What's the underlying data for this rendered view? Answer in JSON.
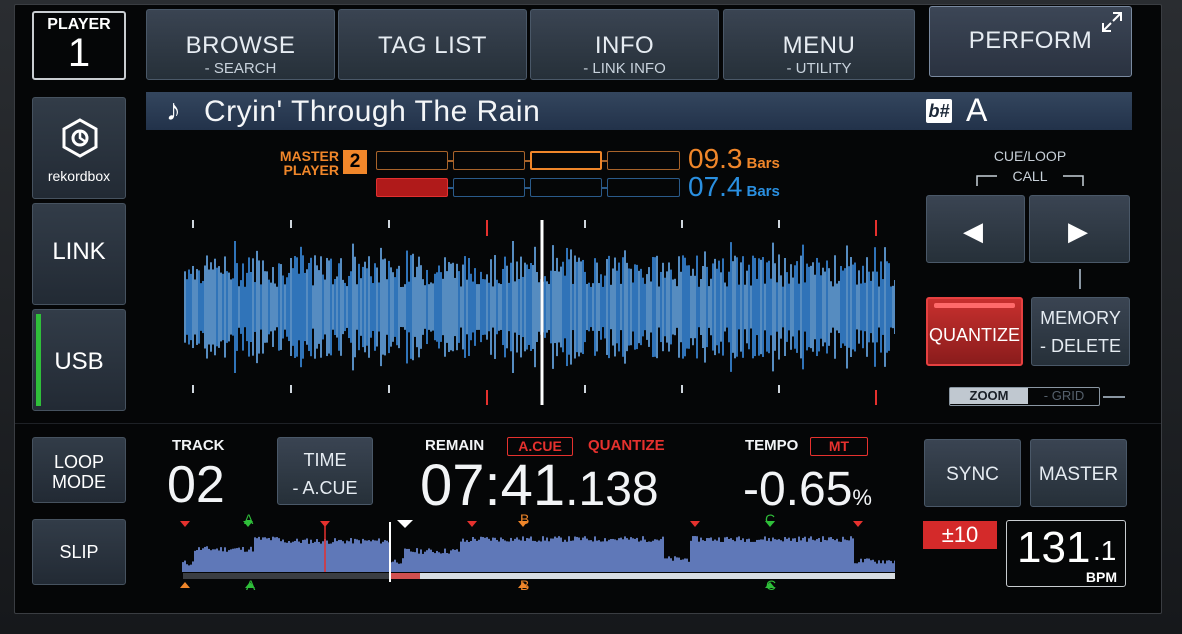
{
  "player": {
    "label": "PLAYER",
    "number": "1"
  },
  "top_buttons": [
    {
      "main": "BROWSE",
      "sub": "- SEARCH"
    },
    {
      "main": "TAG LIST",
      "sub": ""
    },
    {
      "main": "INFO",
      "sub": "- LINK INFO"
    },
    {
      "main": "MENU",
      "sub": "- UTILITY"
    }
  ],
  "perform": {
    "label": "PERFORM"
  },
  "side": {
    "rekordbox": "rekordbox",
    "link": "LINK",
    "usb": "USB",
    "loop_mode": "LOOP MODE",
    "slip": "SLIP"
  },
  "track": {
    "title": "Cryin' Through The Rain",
    "key": "A",
    "key_icon": "b#"
  },
  "phrase": {
    "master_label": "MASTER",
    "player_label": "PLAYER",
    "master_player_num": "2",
    "upper_bars": "09.3",
    "lower_bars": "07.4",
    "bars_unit": "Bars"
  },
  "cue_loop": {
    "label": "CUE/LOOP",
    "call": "CALL"
  },
  "quantize_btn": "QUANTIZE",
  "memory": {
    "main": "MEMORY",
    "sub": "- DELETE"
  },
  "zoom": {
    "zoom": "ZOOM",
    "grid": "- GRID"
  },
  "info": {
    "track_label": "TRACK",
    "track_num": "02",
    "time_btn": {
      "main": "TIME",
      "sub": "- A.CUE"
    },
    "remain_label": "REMAIN",
    "acue_badge": "A.CUE",
    "quantize_label": "QUANTIZE",
    "remain_main": "07:41",
    "remain_ms": ".138",
    "tempo_label": "TEMPO",
    "mt_badge": "MT",
    "tempo_value": "-0.65",
    "tempo_unit": "%"
  },
  "sync": "SYNC",
  "master": "MASTER",
  "tempo_range": "±10",
  "bpm": {
    "whole": "131",
    "decimal": ".1",
    "unit": "BPM"
  },
  "hotcue_markers": {
    "a": "A",
    "b": "B",
    "c": "C"
  },
  "colors": {
    "accent_orange": "#f0862a",
    "accent_blue": "#2a8fe0",
    "red": "#e6312e",
    "green": "#2fbf3a",
    "waveform": "#3b8fe6"
  }
}
